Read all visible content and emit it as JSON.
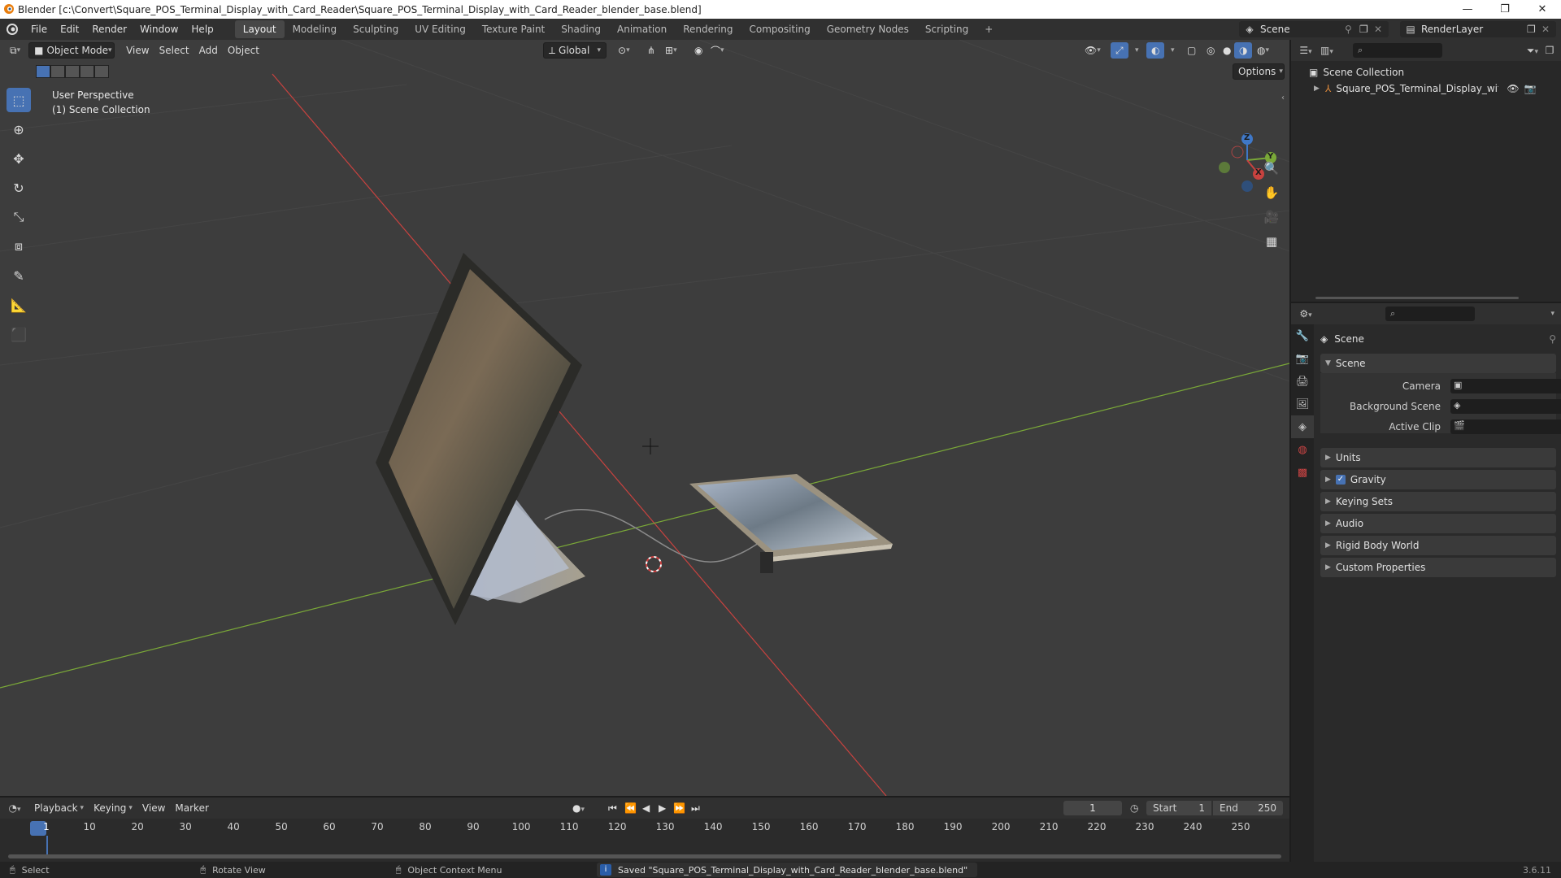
{
  "window": {
    "title": "Blender [c:\\Convert\\Square_POS_Terminal_Display_with_Card_Reader\\Square_POS_Terminal_Display_with_Card_Reader_blender_base.blend]",
    "controls": [
      "—",
      "❐",
      "✕"
    ]
  },
  "menu": {
    "items": [
      "File",
      "Edit",
      "Render",
      "Window",
      "Help"
    ],
    "workspaces": [
      "Layout",
      "Modeling",
      "Sculpting",
      "UV Editing",
      "Texture Paint",
      "Shading",
      "Animation",
      "Rendering",
      "Compositing",
      "Geometry Nodes",
      "Scripting"
    ],
    "active_workspace": "Layout",
    "add_tab": "+",
    "scene": "Scene",
    "view_layer": "RenderLayer"
  },
  "viewport": {
    "mode": "Object Mode",
    "menus": [
      "View",
      "Select",
      "Add",
      "Object"
    ],
    "orientation": "Global",
    "options": "Options",
    "overlay_line1": "User Perspective",
    "overlay_line2": "(1) Scene Collection",
    "gizmo_axes": {
      "x": "X",
      "y": "Y",
      "z": "Z"
    }
  },
  "outliner": {
    "root": "Scene Collection",
    "object": "Square_POS_Terminal_Display_with_Ca"
  },
  "properties": {
    "title": "Scene",
    "panel": "Scene",
    "fields": [
      {
        "label": "Camera"
      },
      {
        "label": "Background Scene"
      },
      {
        "label": "Active Clip"
      }
    ],
    "sections": [
      "Units",
      "Gravity",
      "Keying Sets",
      "Audio",
      "Rigid Body World",
      "Custom Properties"
    ],
    "gravity_checked": true
  },
  "timeline": {
    "menus": [
      "Playback",
      "Keying",
      "View",
      "Marker"
    ],
    "current_frame": "1",
    "start_label": "Start",
    "start": "1",
    "end_label": "End",
    "end": "250",
    "ticks": [
      "1",
      "10",
      "20",
      "30",
      "40",
      "50",
      "60",
      "70",
      "80",
      "90",
      "100",
      "110",
      "120",
      "130",
      "140",
      "150",
      "160",
      "170",
      "180",
      "190",
      "200",
      "210",
      "220",
      "230",
      "240",
      "250"
    ]
  },
  "status": {
    "select": "Select",
    "rotate": "Rotate View",
    "context": "Object Context Menu",
    "message": "Saved \"Square_POS_Terminal_Display_with_Card_Reader_blender_base.blend\"",
    "version": "3.6.11"
  },
  "colors": {
    "accent": "#4772b3",
    "x_axis": "#c8423f",
    "y_axis": "#7aa838",
    "z_axis": "#3f78c8"
  }
}
